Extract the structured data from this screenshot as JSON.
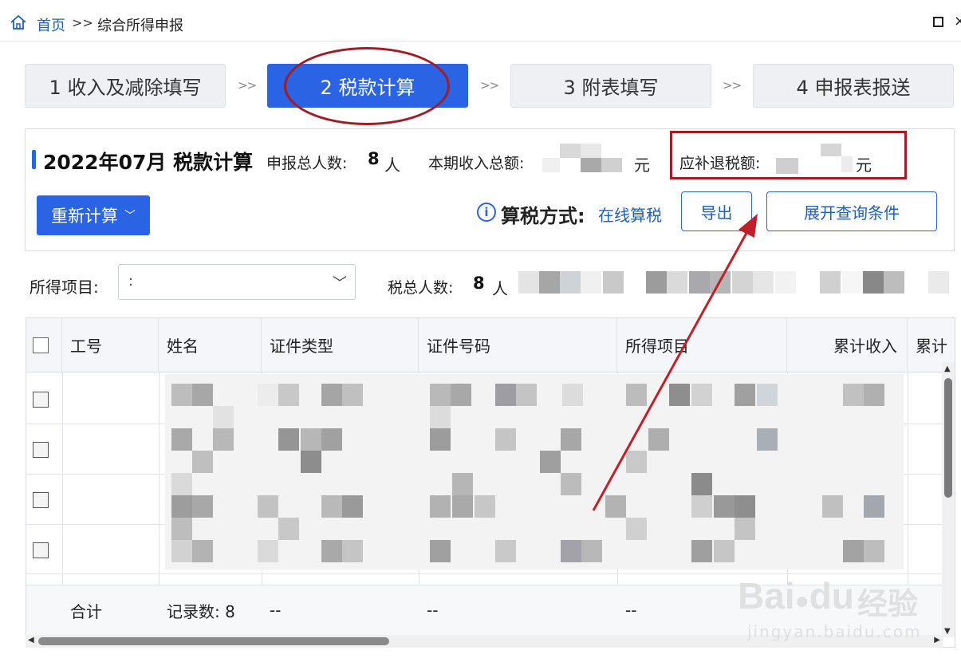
{
  "breadcrumb": {
    "home": "首页",
    "separator": ">>",
    "current": "综合所得申报"
  },
  "steps": [
    {
      "label": "1 收入及减除填写"
    },
    {
      "label": "2 税款计算"
    },
    {
      "label": "3 附表填写"
    },
    {
      "label": "4 申报表报送"
    }
  ],
  "step_separator": ">>",
  "summary": {
    "title": "2022年07月  税款计算",
    "declarants_label": "申报总人数:",
    "declarants_value": "8",
    "declarants_unit": "人",
    "income_label": "本期收入总额:",
    "income_unit": "元",
    "refund_label": "应补退税额:",
    "refund_unit": "元"
  },
  "actions": {
    "recalc": "重新计算",
    "calc_method_label": "算税方式:",
    "calc_method_value": "在线算税",
    "export": "导出",
    "expand_query": "展开查询条件"
  },
  "filter": {
    "income_item_label": "所得项目:",
    "income_item_value": ":",
    "count_label": "税总人数:",
    "count_value": "8",
    "count_unit": "人"
  },
  "table": {
    "headers": [
      "工号",
      "姓名",
      "证件类型",
      "证件号码",
      "所得项目",
      "累计收入",
      "累计"
    ],
    "footer": {
      "label": "合计",
      "records": "记录数: 8",
      "dash1": "--",
      "dash2": "--",
      "dash3": "--"
    }
  },
  "watermark": {
    "brand": "Bai",
    "brand2": "du",
    "cn": "经验",
    "url": "jingyan.baidu.com"
  },
  "colors": {
    "primary": "#2a63e4",
    "annotation_red": "#a31c23"
  }
}
